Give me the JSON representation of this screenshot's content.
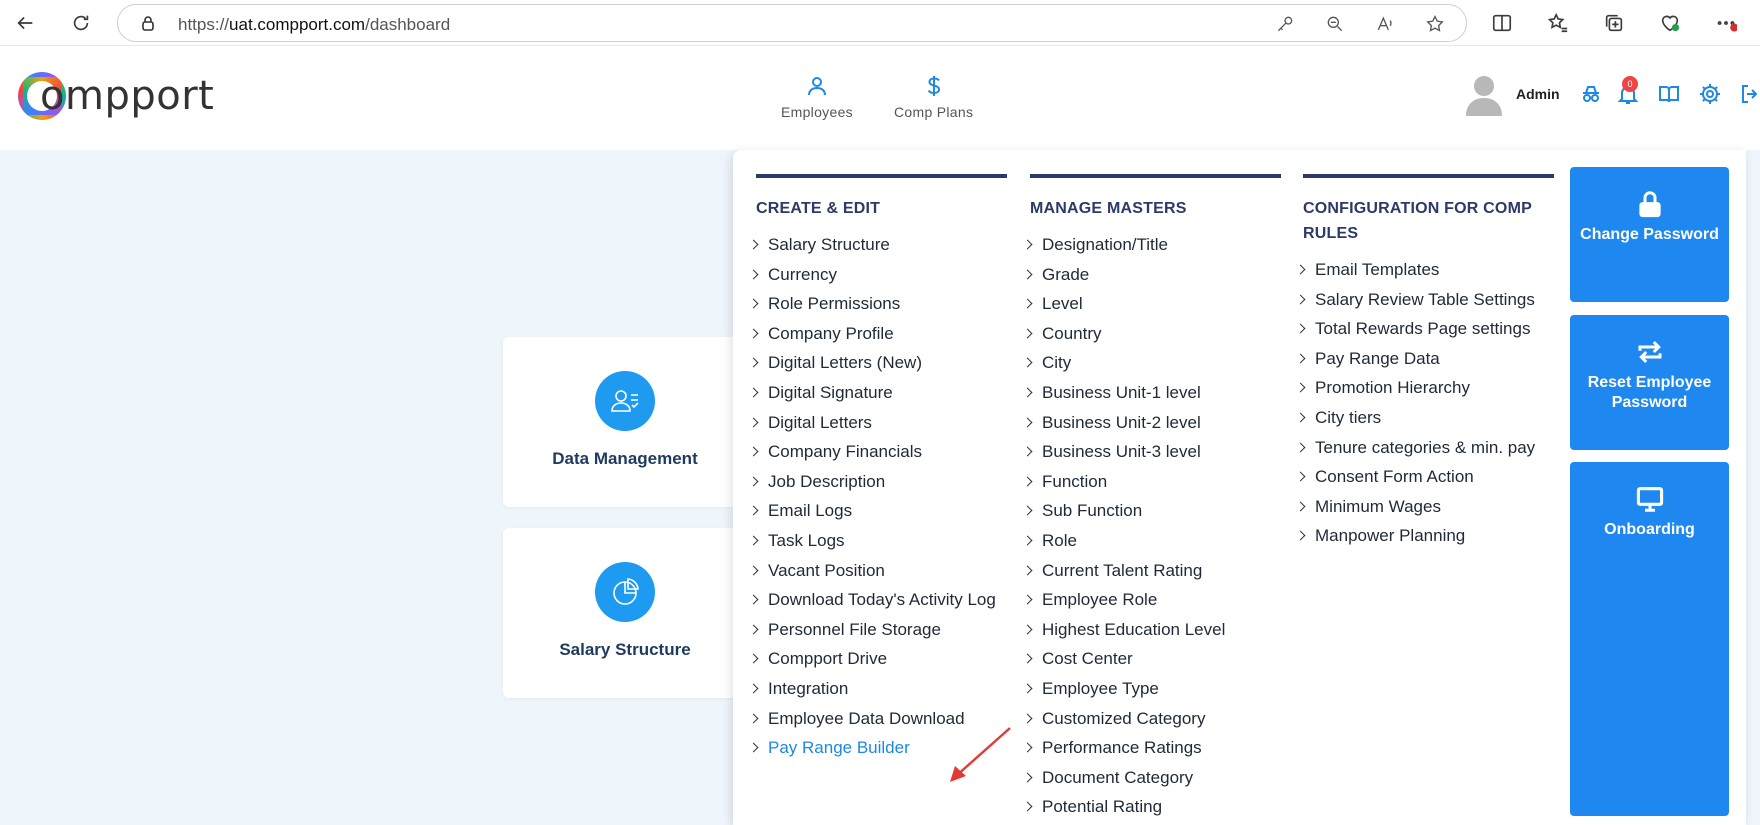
{
  "browser": {
    "url_prefix": "https://",
    "url_host": "uat.compport.com",
    "url_path": "/dashboard"
  },
  "header": {
    "logo_text": "ompport",
    "nav": [
      {
        "label": "Employees",
        "icon": "person-icon"
      },
      {
        "label": "Comp Plans",
        "icon": "dollar-icon"
      }
    ],
    "user_label": "Admin",
    "notification_count": "0"
  },
  "cards": [
    {
      "title": "Data Management",
      "icon": "user-list-icon"
    },
    {
      "title": "Salary Structure",
      "icon": "pie-chart-icon"
    }
  ],
  "menu": {
    "create_edit": {
      "heading": "CREATE & EDIT",
      "items": [
        "Salary Structure",
        "Currency",
        "Role Permissions",
        "Company Profile",
        "Digital Letters (New)",
        "Digital Signature",
        "Digital Letters",
        "Company Financials",
        "Job Description",
        "Email Logs",
        "Task Logs",
        "Vacant Position",
        "Download Today's Activity Log",
        "Personnel File Storage",
        "Compport Drive",
        "Integration",
        "Employee Data Download",
        "Pay Range Builder"
      ],
      "active_index": 17
    },
    "manage_masters": {
      "heading": "MANAGE MASTERS",
      "items": [
        "Designation/Title",
        "Grade",
        "Level",
        "Country",
        "City",
        "Business Unit-1 level",
        "Business Unit-2 level",
        "Business Unit-3 level",
        "Function",
        "Sub Function",
        "Role",
        "Current Talent Rating",
        "Employee Role",
        "Highest Education Level",
        "Cost Center",
        "Employee Type",
        "Customized Category",
        "Performance Ratings",
        "Document Category",
        "Potential Rating"
      ]
    },
    "config_comp_rules": {
      "heading": "CONFIGURATION FOR COMP RULES",
      "items": [
        "Email Templates",
        "Salary Review Table Settings",
        "Total Rewards Page settings",
        "Pay Range Data",
        "Promotion Hierarchy",
        "City tiers",
        "Tenure categories & min. pay",
        "Consent Form Action",
        "Minimum Wages",
        "Manpower Planning"
      ]
    },
    "actions": [
      {
        "label": "Change Password",
        "icon": "lock-icon"
      },
      {
        "label": "Reset Employee Password",
        "icon": "repeat-icon"
      },
      {
        "label": "Onboarding",
        "icon": "monitor-icon"
      }
    ]
  },
  "colors": {
    "accent": "#1e88e5",
    "heading": "#2b3a67",
    "main_bg": "#eef5fb",
    "annotation_arrow": "#e53935"
  }
}
